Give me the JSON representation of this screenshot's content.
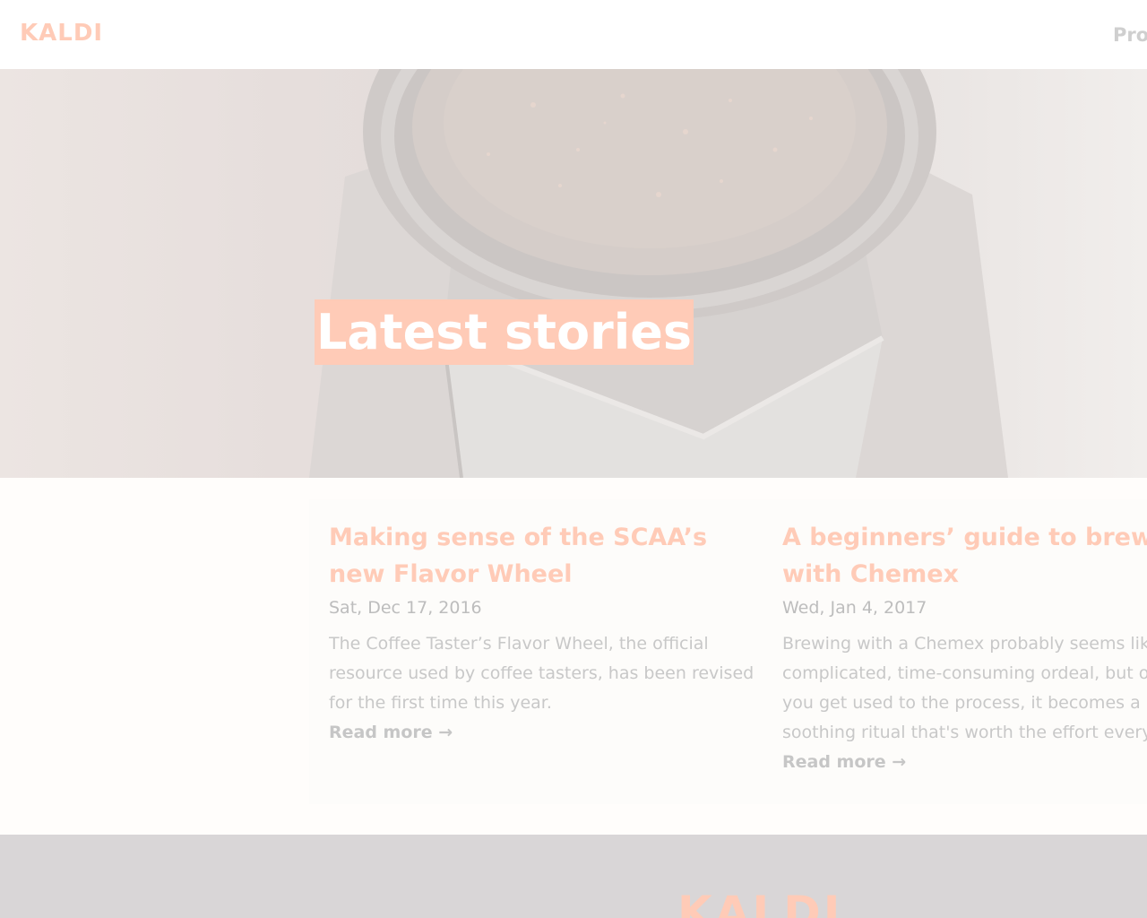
{
  "nav": {
    "brand": "KALDI",
    "items": [
      {
        "label": "Pro"
      }
    ]
  },
  "hero": {
    "title": "Latest stories"
  },
  "stories": [
    {
      "title_lines": [
        "Making sense of the SCAA’s",
        "new Flavor Wheel"
      ],
      "date": "Sat, Dec 17, 2016",
      "excerpt_lines": [
        "The Coffee Taster’s Flavor Wheel, the official",
        "resource used by coffee tasters, has been revised",
        "for the first time this year."
      ],
      "read_more": "Read more →"
    },
    {
      "title_lines": [
        "A beginners’ guide to brewing",
        "with Chemex"
      ],
      "date": "Wed, Jan 4, 2017",
      "excerpt_lines": [
        "Brewing with a Chemex probably seems like a",
        "complicated, time-consuming ordeal, but once",
        "you get used to the process, it becomes a",
        "soothing ritual that's worth the effort every time."
      ],
      "read_more": "Read more →"
    }
  ],
  "footer": {
    "logo": "KALDI"
  },
  "colors": {
    "accent": "#ffcbb7",
    "hero_background": "#e4dedb",
    "footer_background": "#d9d6d7"
  },
  "icons": {
    "hero_image": "moka-pot-photo"
  }
}
